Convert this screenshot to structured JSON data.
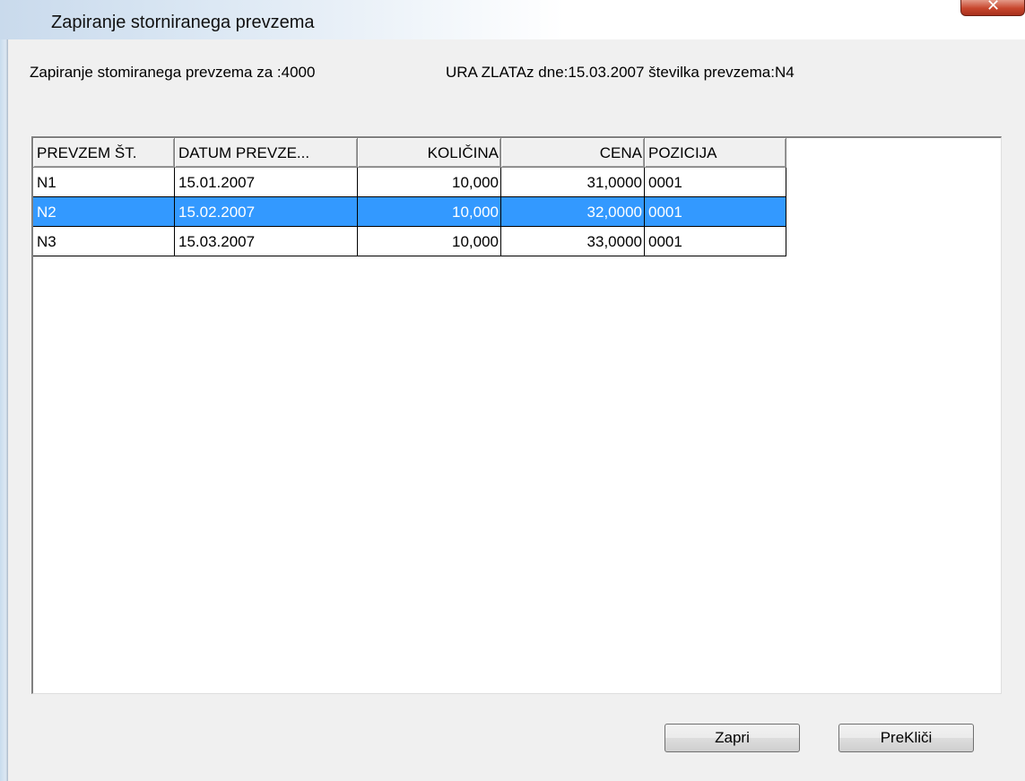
{
  "window": {
    "title": "Zapiranje storniranega prevzema"
  },
  "info": {
    "left_text": "Zapiranje stomiranega prevzema za :4000",
    "right_text": "URA ZLATAz dne:15.03.2007 številka prevzema:N4"
  },
  "table": {
    "headers": [
      "PREVZEM ŠT.",
      "DATUM PREVZE...",
      "KOLIČINA",
      "CENA",
      "POZICIJA"
    ],
    "rows": [
      [
        "N1",
        "15.01.2007",
        "10,000",
        "31,0000",
        "0001"
      ],
      [
        "N2",
        "15.02.2007",
        "10,000",
        "32,0000",
        "0001"
      ],
      [
        "N3",
        "15.03.2007",
        "10,000",
        "33,0000",
        "0001"
      ]
    ],
    "selected_row": 1
  },
  "buttons": {
    "close_label": "Zapri",
    "cancel_label": "PreKliči"
  },
  "colors": {
    "selection": "#3399ff",
    "close_button": "#c7462d"
  }
}
